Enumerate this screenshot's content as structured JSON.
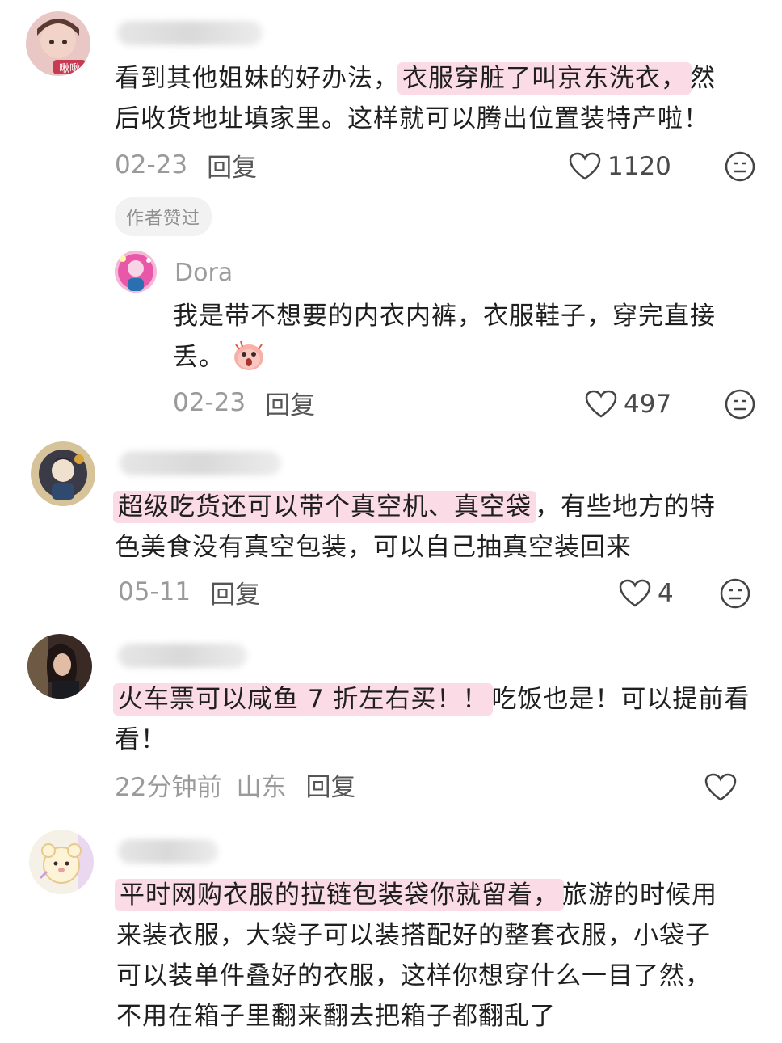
{
  "comments": [
    {
      "body_hl": "衣服穿脏了叫京东洗衣，",
      "body_pre": "看到其他姐妹的好办法，",
      "body_post": "然",
      "body_line2": "后收货地址填家里。这样就可以腾出位置装特产啦！",
      "date": "02-23",
      "reply": "回复",
      "likes": "1120",
      "badge": "作者赞过",
      "avatar_text": "啾啾"
    },
    {
      "username": "Dora",
      "body_line1": "我是带不想要的内衣内裤，衣服鞋子，穿完直接",
      "body_line2": "丢。",
      "date": "02-23",
      "reply": "回复",
      "likes": "497"
    },
    {
      "body_hl": "超级吃货还可以带个真空机、真空袋",
      "body_post": "，有些地方的特",
      "body_line2": "色美食没有真空包装，可以自己抽真空装回来",
      "date": "05-11",
      "reply": "回复",
      "likes": "4"
    },
    {
      "body_hl": "火车票可以咸鱼 7 折左右买！！",
      "body_post": "吃饭也是！可以提前看",
      "body_line2": "看！",
      "date": "22分钟前",
      "location": "山东",
      "reply": "回复"
    },
    {
      "body_hl": "平时网购衣服的拉链包装袋你就留着，",
      "body_post": "旅游的时候用",
      "body_line2": "来装衣服，大袋子可以装搭配好的整套衣服，小袋子",
      "body_line3": "可以装单件叠好的衣服，这样你想穿什么一目了然，",
      "body_line4": "不用在箱子里翻来翻去把箱子都翻乱了"
    }
  ],
  "colors": {
    "highlight": "#fbdbe6",
    "meta": "#9a9a9a",
    "text": "#1f1f1f"
  }
}
